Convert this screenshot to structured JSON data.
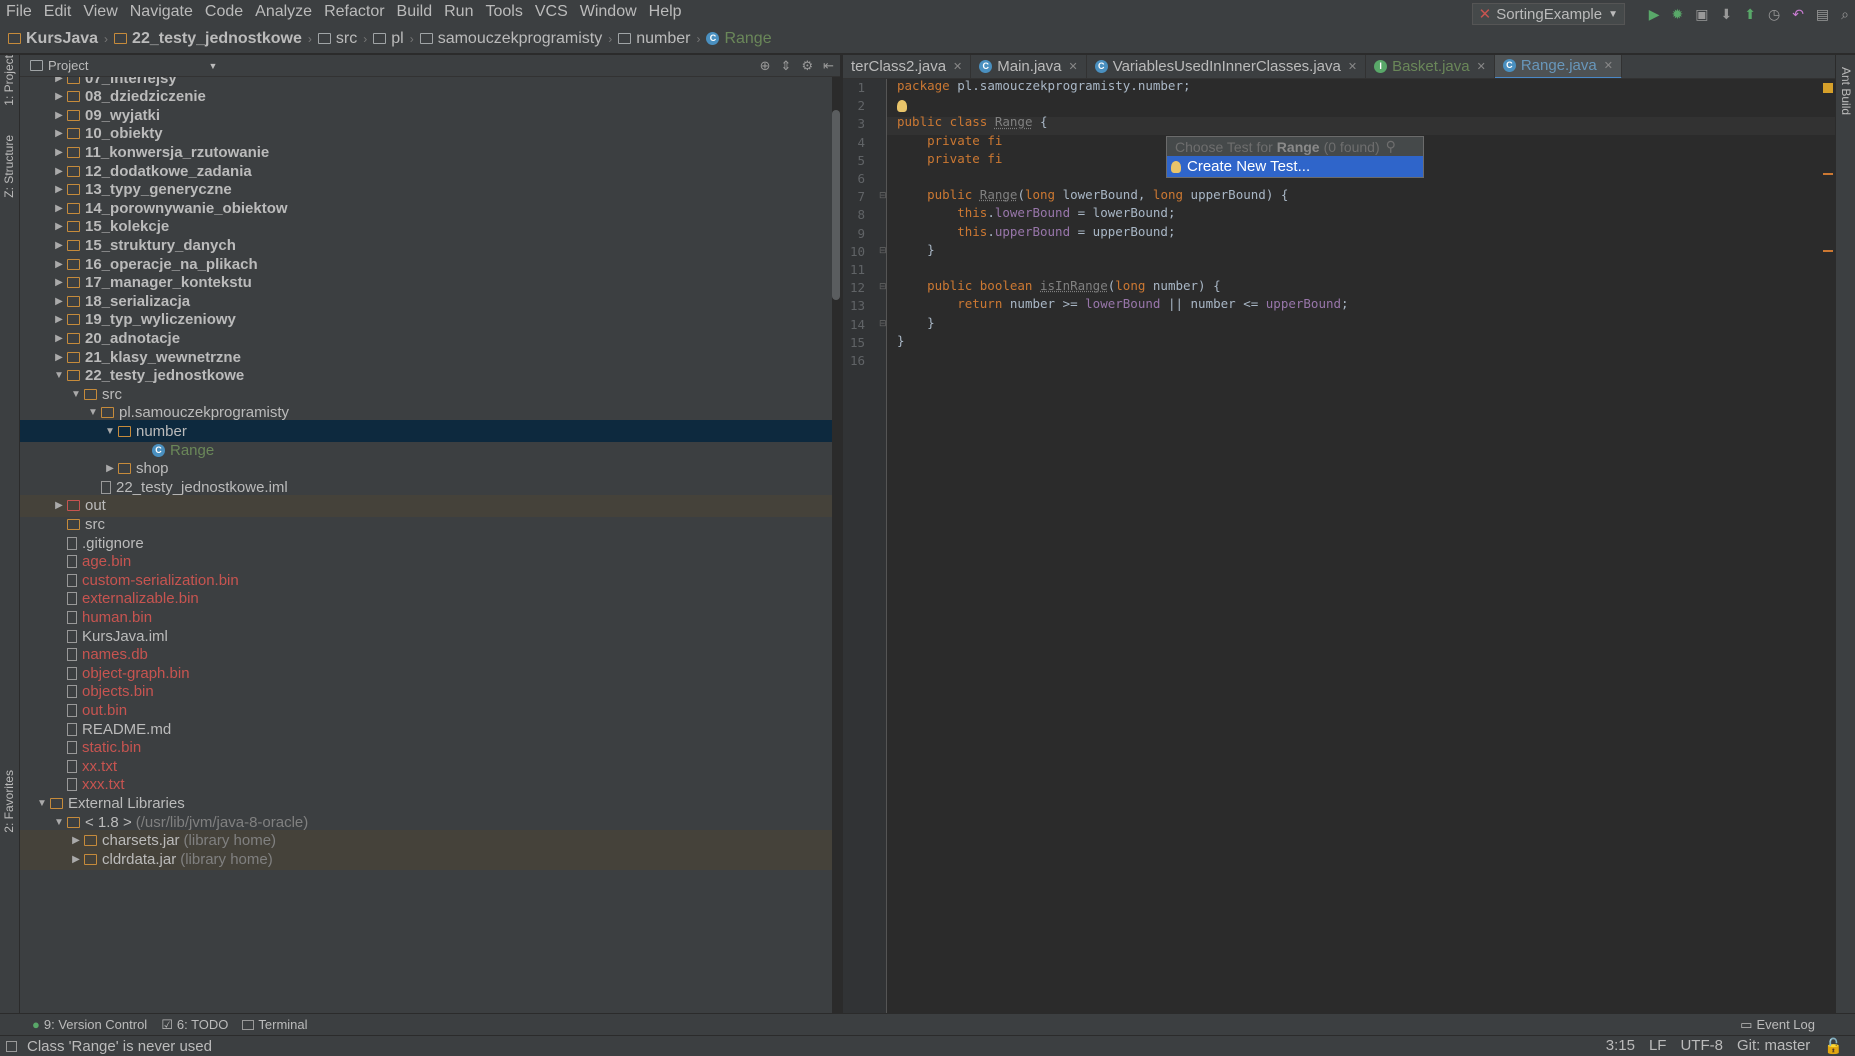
{
  "menu": [
    "File",
    "Edit",
    "View",
    "Navigate",
    "Code",
    "Analyze",
    "Refactor",
    "Build",
    "Run",
    "Tools",
    "VCS",
    "Window",
    "Help"
  ],
  "breadcrumbs": [
    {
      "label": "KursJava",
      "icon": "project-folder-icon",
      "bold": true
    },
    {
      "label": "22_testy_jednostkowe",
      "icon": "module-folder-icon",
      "bold": true
    },
    {
      "label": "src",
      "icon": "source-folder-icon"
    },
    {
      "label": "pl",
      "icon": "package-icon"
    },
    {
      "label": "samouczekprogramisty",
      "icon": "package-icon"
    },
    {
      "label": "number",
      "icon": "package-icon"
    },
    {
      "label": "Range",
      "icon": "class-icon",
      "active": true
    }
  ],
  "run_config": "SortingExample",
  "project_panel": {
    "title": "Project"
  },
  "tree": [
    {
      "label": "07_interfejsy",
      "depth": 1,
      "bold": true,
      "arrow": "right",
      "icon": "folder"
    },
    {
      "label": "08_dziedziczenie",
      "depth": 1,
      "bold": true,
      "arrow": "right",
      "icon": "folder"
    },
    {
      "label": "09_wyjatki",
      "depth": 1,
      "bold": true,
      "arrow": "right",
      "icon": "folder"
    },
    {
      "label": "10_obiekty",
      "depth": 1,
      "bold": true,
      "arrow": "right",
      "icon": "folder"
    },
    {
      "label": "11_konwersja_rzutowanie",
      "depth": 1,
      "bold": true,
      "arrow": "right",
      "icon": "folder"
    },
    {
      "label": "12_dodatkowe_zadania",
      "depth": 1,
      "bold": true,
      "arrow": "right",
      "icon": "folder"
    },
    {
      "label": "13_typy_generyczne",
      "depth": 1,
      "bold": true,
      "arrow": "right",
      "icon": "folder"
    },
    {
      "label": "14_porownywanie_obiektow",
      "depth": 1,
      "bold": true,
      "arrow": "right",
      "icon": "folder"
    },
    {
      "label": "15_kolekcje",
      "depth": 1,
      "bold": true,
      "arrow": "right",
      "icon": "folder"
    },
    {
      "label": "15_struktury_danych",
      "depth": 1,
      "bold": true,
      "arrow": "right",
      "icon": "folder"
    },
    {
      "label": "16_operacje_na_plikach",
      "depth": 1,
      "bold": true,
      "arrow": "right",
      "icon": "folder"
    },
    {
      "label": "17_manager_kontekstu",
      "depth": 1,
      "bold": true,
      "arrow": "right",
      "icon": "folder"
    },
    {
      "label": "18_serializacja",
      "depth": 1,
      "bold": true,
      "arrow": "right",
      "icon": "folder"
    },
    {
      "label": "19_typ_wyliczeniowy",
      "depth": 1,
      "bold": true,
      "arrow": "right",
      "icon": "folder"
    },
    {
      "label": "20_adnotacje",
      "depth": 1,
      "bold": true,
      "arrow": "right",
      "icon": "folder"
    },
    {
      "label": "21_klasy_wewnetrzne",
      "depth": 1,
      "bold": true,
      "arrow": "right",
      "icon": "folder"
    },
    {
      "label": "22_testy_jednostkowe",
      "depth": 1,
      "bold": true,
      "arrow": "down",
      "icon": "folder"
    },
    {
      "label": "src",
      "depth": 2,
      "arrow": "down",
      "icon": "folder"
    },
    {
      "label": "pl.samouczekprogramisty",
      "depth": 3,
      "arrow": "down",
      "icon": "package"
    },
    {
      "label": "number",
      "depth": 4,
      "arrow": "down",
      "icon": "package",
      "selected": true
    },
    {
      "label": "Range",
      "depth": 6,
      "icon": "class",
      "color": "green"
    },
    {
      "label": "shop",
      "depth": 4,
      "arrow": "right",
      "icon": "package"
    },
    {
      "label": "22_testy_jednostkowe.iml",
      "depth": 3,
      "icon": "iml"
    },
    {
      "label": "out",
      "depth": 1,
      "arrow": "right",
      "icon": "folder-red",
      "shaded": true
    },
    {
      "label": "src",
      "depth": 1,
      "icon": "folder"
    },
    {
      "label": ".gitignore",
      "depth": 1,
      "icon": "file"
    },
    {
      "label": "age.bin",
      "depth": 1,
      "icon": "file",
      "color": "red"
    },
    {
      "label": "custom-serialization.bin",
      "depth": 1,
      "icon": "file",
      "color": "red"
    },
    {
      "label": "externalizable.bin",
      "depth": 1,
      "icon": "file",
      "color": "red"
    },
    {
      "label": "human.bin",
      "depth": 1,
      "icon": "file",
      "color": "red"
    },
    {
      "label": "KursJava.iml",
      "depth": 1,
      "icon": "iml"
    },
    {
      "label": "names.db",
      "depth": 1,
      "icon": "file",
      "color": "red"
    },
    {
      "label": "object-graph.bin",
      "depth": 1,
      "icon": "file",
      "color": "red"
    },
    {
      "label": "objects.bin",
      "depth": 1,
      "icon": "file",
      "color": "red"
    },
    {
      "label": "out.bin",
      "depth": 1,
      "icon": "file",
      "color": "red"
    },
    {
      "label": "README.md",
      "depth": 1,
      "icon": "file"
    },
    {
      "label": "static.bin",
      "depth": 1,
      "icon": "file",
      "color": "red"
    },
    {
      "label": "xx.txt",
      "depth": 1,
      "icon": "file",
      "color": "red"
    },
    {
      "label": "xxx.txt",
      "depth": 1,
      "icon": "file",
      "color": "red"
    },
    {
      "label": "External Libraries",
      "depth": 0,
      "arrow": "down",
      "icon": "library"
    },
    {
      "label": "< 1.8 >",
      "suffix": "(/usr/lib/jvm/java-8-oracle)",
      "depth": 1,
      "arrow": "down",
      "icon": "folder"
    },
    {
      "label": "charsets.jar",
      "suffix": "(library home)",
      "depth": 2,
      "arrow": "right",
      "icon": "jar",
      "shaded": true
    },
    {
      "label": "cldrdata.jar",
      "suffix": "(library home)",
      "depth": 2,
      "arrow": "right",
      "icon": "jar",
      "shaded": true
    }
  ],
  "tabs": [
    {
      "label": "terClass2.java",
      "active": false
    },
    {
      "label": "Main.java",
      "active": false,
      "icon": "class"
    },
    {
      "label": "VariablesUsedInInnerClasses.java",
      "active": false,
      "icon": "class"
    },
    {
      "label": "Basket.java",
      "active": false,
      "icon": "interface",
      "green": true
    },
    {
      "label": "Range.java",
      "active": true,
      "icon": "class"
    }
  ],
  "code_lines": [
    [
      {
        "t": "package",
        "c": "kw"
      },
      {
        "t": " pl.samouczekprogramisty.number;",
        "c": ""
      }
    ],
    [],
    [
      {
        "t": "public class",
        "c": "kw"
      },
      {
        "t": " ",
        "c": ""
      },
      {
        "t": "Range",
        "c": "unused"
      },
      {
        "t": " {",
        "c": ""
      }
    ],
    [
      {
        "t": "    private ",
        "c": "kw"
      },
      {
        "t": "fi",
        "c": "kw"
      }
    ],
    [
      {
        "t": "    private ",
        "c": "kw"
      },
      {
        "t": "fi",
        "c": "kw"
      }
    ],
    [],
    [
      {
        "t": "    public ",
        "c": "kw"
      },
      {
        "t": "Range",
        "c": "unused"
      },
      {
        "t": "(",
        "c": ""
      },
      {
        "t": "long",
        "c": "kw"
      },
      {
        "t": " lowerBound, ",
        "c": ""
      },
      {
        "t": "long",
        "c": "kw"
      },
      {
        "t": " upperBound) {",
        "c": ""
      }
    ],
    [
      {
        "t": "        this",
        "c": "kw"
      },
      {
        "t": ".",
        "c": ""
      },
      {
        "t": "lowerBound",
        "c": "fld"
      },
      {
        "t": " = lowerBound;",
        "c": ""
      }
    ],
    [
      {
        "t": "        this",
        "c": "kw"
      },
      {
        "t": ".",
        "c": ""
      },
      {
        "t": "upperBound",
        "c": "fld"
      },
      {
        "t": " = upperBound;",
        "c": ""
      }
    ],
    [
      {
        "t": "    }",
        "c": ""
      }
    ],
    [],
    [
      {
        "t": "    public boolean ",
        "c": "kw"
      },
      {
        "t": "isInRange",
        "c": "unused"
      },
      {
        "t": "(",
        "c": ""
      },
      {
        "t": "long",
        "c": "kw"
      },
      {
        "t": " number) {",
        "c": ""
      }
    ],
    [
      {
        "t": "        return ",
        "c": "kw"
      },
      {
        "t": "number >= ",
        "c": ""
      },
      {
        "t": "lowerBound",
        "c": "fld"
      },
      {
        "t": " || number <= ",
        "c": ""
      },
      {
        "t": "upperBound",
        "c": "fld"
      },
      {
        "t": ";",
        "c": ""
      }
    ],
    [
      {
        "t": "    }",
        "c": ""
      }
    ],
    [
      {
        "t": "}",
        "c": ""
      }
    ],
    []
  ],
  "popup": {
    "header_prefix": "Choose Test for",
    "header_class": "Range",
    "header_suffix": "(0 found)",
    "item": "Create New Test..."
  },
  "toolwindows": [
    {
      "label": "9: Version Control",
      "icon": "vcs-icon"
    },
    {
      "label": "6: TODO",
      "icon": "todo-icon"
    },
    {
      "label": "Terminal",
      "icon": "terminal-icon"
    }
  ],
  "event_log": "Event Log",
  "status": {
    "message": "Class 'Range' is never used",
    "position": "3:15",
    "line_sep": "LF",
    "encoding": "UTF-8",
    "git": "Git: master"
  },
  "left_tabs": {
    "project": "1: Project",
    "structure": "Z: Structure",
    "favorites": "2: Favorites"
  },
  "right_tabs": {
    "ant": "Ant Build"
  }
}
